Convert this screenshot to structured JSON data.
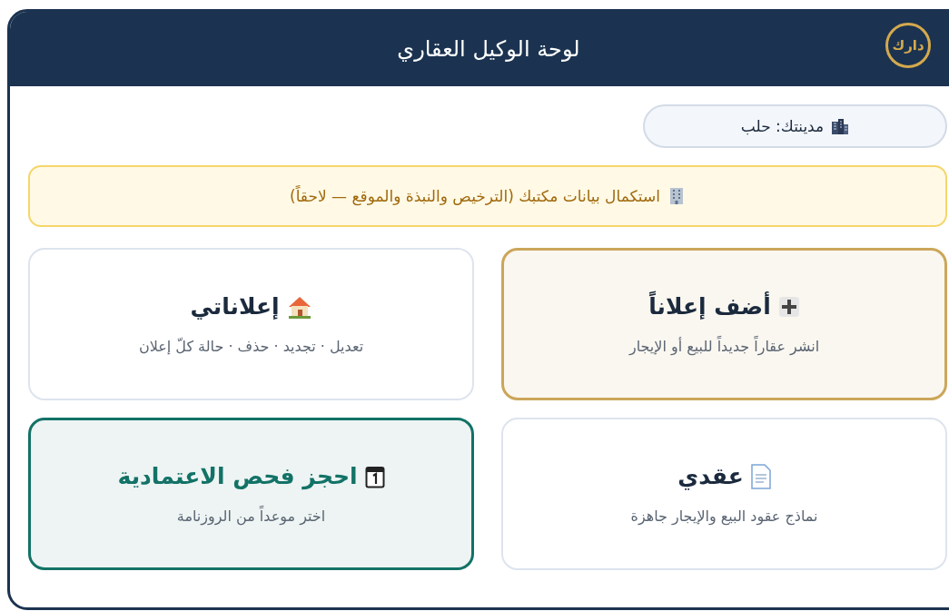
{
  "header": {
    "title": "لوحة الوكيل العقاري",
    "logo": "دارك"
  },
  "city": {
    "label": "مدينتك: حلب"
  },
  "notice": {
    "text": "استكمال بيانات مكتبك (الترخيص والنبذة والموقع — لاحقاً)"
  },
  "cards": [
    {
      "kind": "highlight",
      "title": "أضف إعلاناً",
      "subtitle": "انشر عقاراً جديداً للبيع أو الإيجار"
    },
    {
      "kind": "plain",
      "title": "إعلاناتي",
      "subtitle": "تعديل · تجديد · حذف · حالة كلّ إعلان"
    },
    {
      "kind": "plain",
      "title": "عقدي",
      "subtitle": "نماذج عقود البيع والإيجار جاهزة"
    },
    {
      "kind": "booking",
      "title": "احجز فحص الاعتمادية",
      "subtitle": "اختر موعداً من الروزنامة"
    }
  ]
}
